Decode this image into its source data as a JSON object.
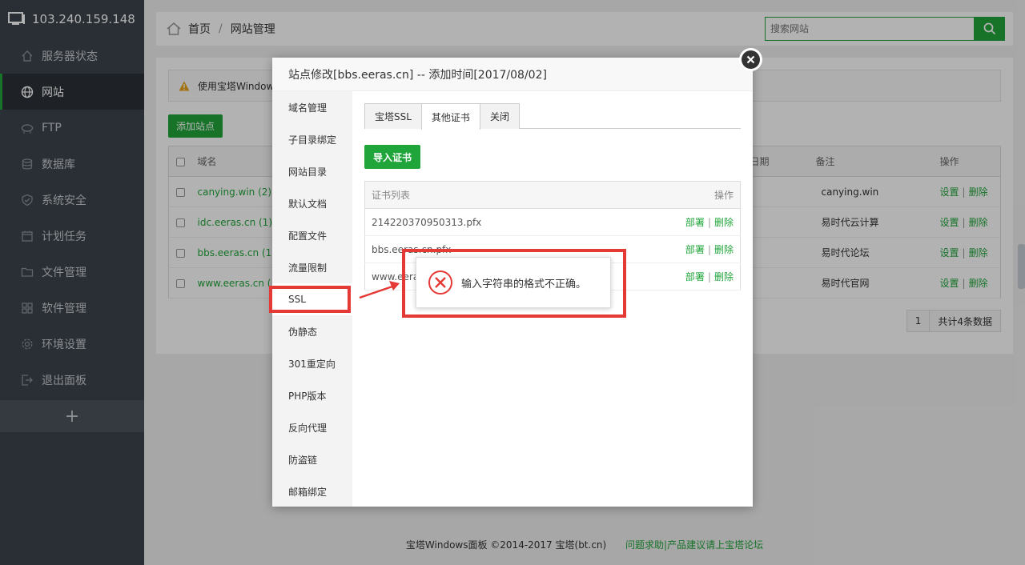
{
  "sidebar": {
    "server_ip": "103.240.159.148",
    "items": [
      {
        "label": "服务器状态",
        "icon": "home-icon"
      },
      {
        "label": "网站",
        "icon": "globe-icon",
        "active": true
      },
      {
        "label": "FTP",
        "icon": "ftp-icon"
      },
      {
        "label": "数据库",
        "icon": "database-icon"
      },
      {
        "label": "系统安全",
        "icon": "shield-icon"
      },
      {
        "label": "计划任务",
        "icon": "calendar-icon"
      },
      {
        "label": "文件管理",
        "icon": "folder-icon"
      },
      {
        "label": "软件管理",
        "icon": "grid-icon"
      },
      {
        "label": "环境设置",
        "icon": "gear-icon"
      },
      {
        "label": "退出面板",
        "icon": "logout-icon"
      }
    ],
    "add_label": "+"
  },
  "breadcrumb": {
    "home": "首页",
    "sep": "/",
    "current": "网站管理"
  },
  "search": {
    "placeholder": "搜索网站"
  },
  "notice": {
    "text": "使用宝塔Window"
  },
  "add_site_label": "添加站点",
  "site_table": {
    "headers": {
      "domain": "域名",
      "date": "日期",
      "note": "备注",
      "ops": "操作"
    },
    "rows": [
      {
        "domain": "canying.win (2)",
        "note": "canying.win",
        "set": "设置",
        "del": "删除"
      },
      {
        "domain": "idc.eeras.cn (1)",
        "note": "易时代云计算",
        "set": "设置",
        "del": "删除"
      },
      {
        "domain": "bbs.eeras.cn (1)",
        "note": "易时代论坛",
        "set": "设置",
        "del": "删除"
      },
      {
        "domain": "www.eeras.cn (1",
        "note": "易时代官网",
        "set": "设置",
        "del": "删除"
      }
    ]
  },
  "pager": {
    "page": "1",
    "total": "共计4条数据"
  },
  "footer": {
    "copyright": "宝塔Windows面板 ©2014-2017 宝塔(bt.cn)",
    "links": "问题求助|产品建议请上宝塔论坛"
  },
  "modal": {
    "title": "站点修改[bbs.eeras.cn] -- 添加时间[2017/08/02]",
    "nav": [
      "域名管理",
      "子目录绑定",
      "网站目录",
      "默认文档",
      "配置文件",
      "流量限制",
      "SSL",
      "伪静态",
      "301重定向",
      "PHP版本",
      "反向代理",
      "防盗链",
      "邮箱绑定"
    ],
    "tabs": [
      "宝塔SSL",
      "其他证书",
      "关闭"
    ],
    "import_label": "导入证书",
    "cert_table": {
      "header_list": "证书列表",
      "header_ops": "操作",
      "rows": [
        {
          "name": "214220370950313.pfx",
          "deploy": "部署",
          "sep": "|",
          "del": "删除"
        },
        {
          "name": "bbs.eeras.cn.pfx",
          "deploy": "部署",
          "sep": "|",
          "del": "删除"
        },
        {
          "name": "www.eera",
          "deploy": "部署",
          "sep": "|",
          "del": "删除"
        }
      ]
    }
  },
  "toast": {
    "message": "输入字符串的格式不正确。"
  },
  "colors": {
    "brand_green": "#20a53a",
    "sidebar_bg": "#3c444d",
    "highlight_red": "#e53935"
  }
}
